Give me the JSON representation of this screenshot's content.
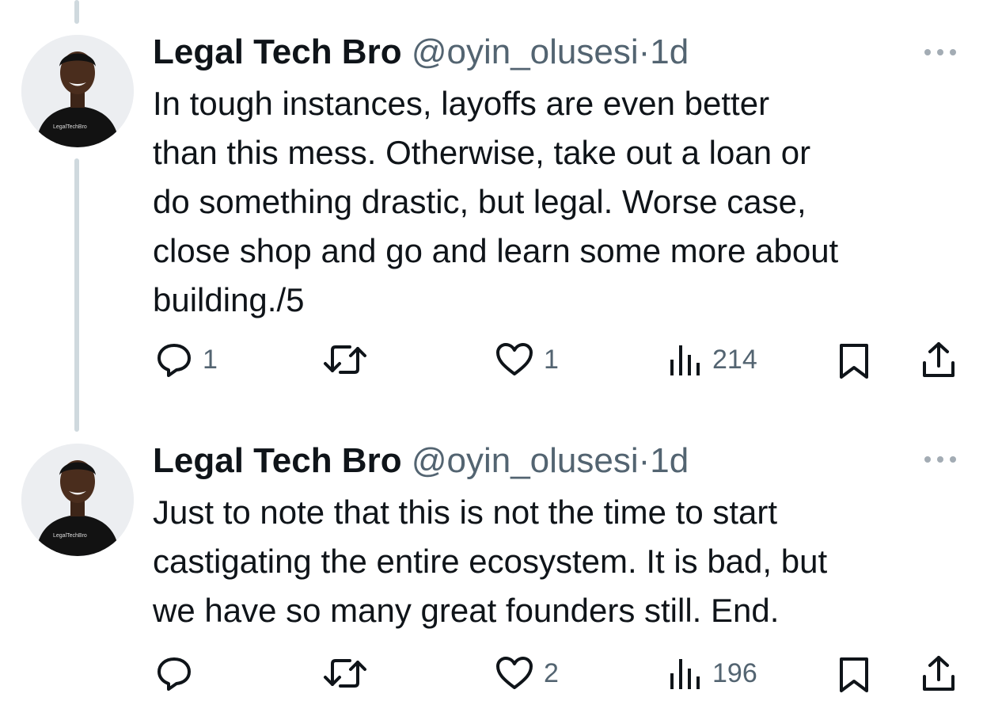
{
  "tweets": [
    {
      "author": {
        "name": "Legal Tech Bro",
        "handle": "@oyin_olusesi",
        "separator": "·",
        "time": "1d",
        "avatar_shirt_text": "LegalTechBro"
      },
      "text": "In tough instances, layoffs are even better\nthan this mess. Otherwise, take out a loan or\ndo something drastic, but legal. Worse case,\nclose shop and go and learn some more about\nbuilding./5",
      "actions": {
        "replies": "1",
        "retweets": "",
        "likes": "1",
        "views": "214"
      }
    },
    {
      "author": {
        "name": "Legal Tech Bro",
        "handle": "@oyin_olusesi",
        "separator": "·",
        "time": "1d",
        "avatar_shirt_text": "LegalTechBro"
      },
      "text": "Just to note that this is not the time to start\ncastigating the entire ecosystem. It is bad, but\nwe have so many great founders still. End.",
      "actions": {
        "replies": "",
        "retweets": "",
        "likes": "2",
        "views": "196"
      }
    }
  ],
  "icons": [
    "reply-icon",
    "retweet-icon",
    "like-icon",
    "views-icon",
    "bookmark-icon",
    "share-icon",
    "more-icon"
  ],
  "colors": {
    "text": "#0f1419",
    "secondary": "#536471",
    "thread_line": "#cfd9de"
  }
}
